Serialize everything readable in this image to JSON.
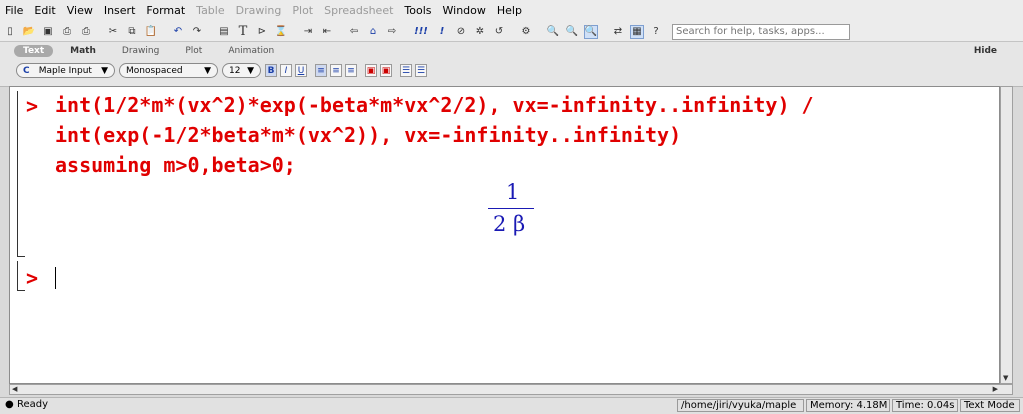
{
  "menubar": {
    "items": [
      {
        "label": "File",
        "enabled": true
      },
      {
        "label": "Edit",
        "enabled": true
      },
      {
        "label": "View",
        "enabled": true
      },
      {
        "label": "Insert",
        "enabled": true
      },
      {
        "label": "Format",
        "enabled": true
      },
      {
        "label": "Table",
        "enabled": false
      },
      {
        "label": "Drawing",
        "enabled": false
      },
      {
        "label": "Plot",
        "enabled": false
      },
      {
        "label": "Spreadsheet",
        "enabled": false
      },
      {
        "label": "Tools",
        "enabled": true
      },
      {
        "label": "Window",
        "enabled": true
      },
      {
        "label": "Help",
        "enabled": true
      }
    ]
  },
  "toolbar": {
    "search_placeholder": "Search for help, tasks, apps...",
    "text_tool": "T",
    "exec_bang": "!!!",
    "exec_single": "!"
  },
  "context_panel": {
    "tabs": [
      "Text",
      "Math",
      "Drawing",
      "Plot",
      "Animation"
    ],
    "active_tab": "Text",
    "hide_label": "Hide",
    "style_combo": "Maple Input",
    "style_icon": "C",
    "font_combo": "Monospaced",
    "size_combo": "12",
    "bold": "B",
    "italic": "I",
    "underline": "U"
  },
  "worksheet": {
    "prompt_symbol": ">",
    "input_lines": [
      "int(1/2*m*(vx^2)*exp(-beta*m*vx^2/2), vx=-infinity..infinity) /",
      "int(exp(-1/2*beta*m*(vx^2)), vx=-infinity..infinity)",
      "assuming m>0,beta>0;"
    ],
    "output": {
      "numerator": "1",
      "denominator": "2 β"
    },
    "next_prompt": ">"
  },
  "statusbar": {
    "state": "Ready",
    "path": "/home/jiri/vyuka/maple",
    "memory": "Memory: 4.18M",
    "time": "Time: 0.04s",
    "mode": "Text Mode"
  },
  "colors": {
    "input_red": "#e00000",
    "output_blue": "#1a1ab4"
  }
}
